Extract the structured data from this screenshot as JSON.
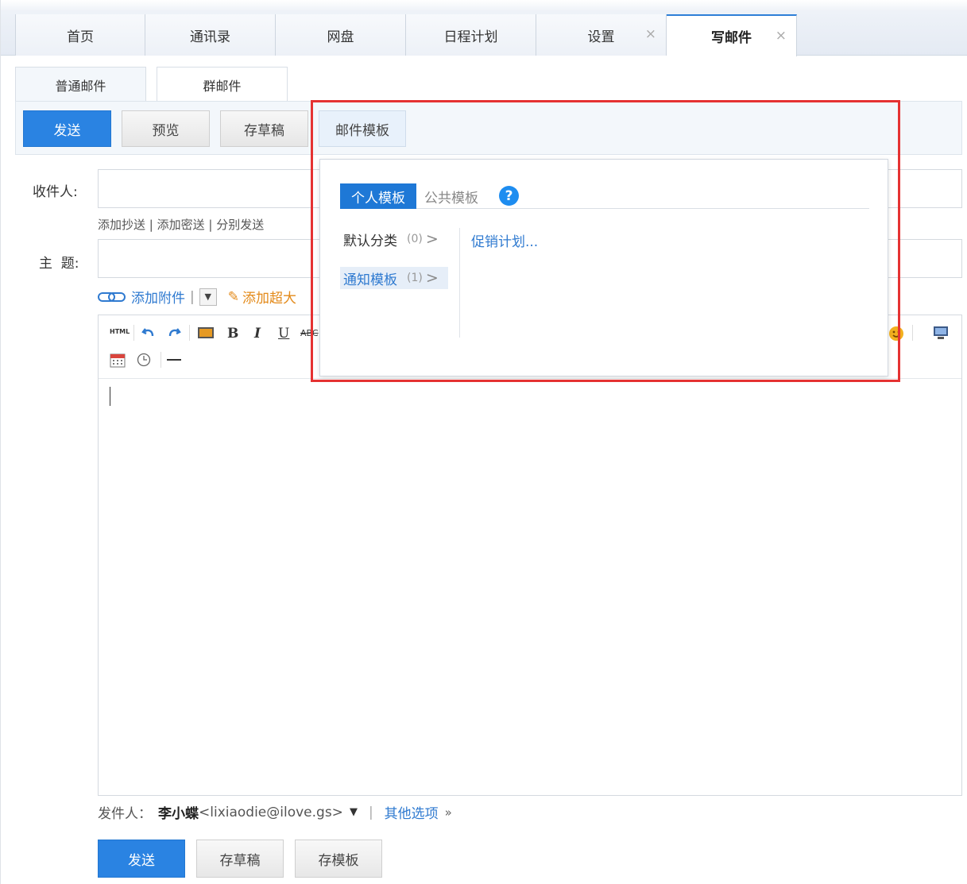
{
  "nav": {
    "tabs": [
      {
        "label": "首页"
      },
      {
        "label": "通讯录"
      },
      {
        "label": "网盘"
      },
      {
        "label": "日程计划"
      },
      {
        "label": "设置",
        "close": "×"
      },
      {
        "label": "写邮件",
        "close": "×"
      }
    ]
  },
  "compose": {
    "type_tabs": [
      {
        "label": "普通邮件"
      },
      {
        "label": "群邮件"
      }
    ],
    "toolbar": {
      "send": "发送",
      "preview": "预览",
      "save_draft": "存草稿",
      "template": "邮件模板"
    },
    "recipient_label": "收件人:",
    "recipient_links": [
      "添加抄送",
      "添加密送",
      "分别发送"
    ],
    "subject_label": "主  题:",
    "attach_label": "添加附件",
    "attach_large_label": "添加超大",
    "editor_tools": {
      "html": "HTML",
      "bold": "B",
      "italic": "I",
      "underline": "U",
      "strike": "ABC"
    }
  },
  "template_popup": {
    "tabs": {
      "personal": "个人模板",
      "public": "公共模板",
      "help": "?"
    },
    "categories": [
      {
        "name": "默认分类",
        "count": "(0)"
      },
      {
        "name": "通知模板",
        "count": "(1)"
      }
    ],
    "items": [
      "促销计划..."
    ]
  },
  "sender": {
    "label": "发件人：",
    "name": "李小蝶",
    "email": "<lixiaodie@ilove.gs>",
    "other_options": "其他选项"
  },
  "bottom_buttons": {
    "send": "发送",
    "save_draft": "存草稿",
    "save_template": "存模板"
  },
  "colors": {
    "primary": "#2a83e2",
    "highlight": "#e53232",
    "link": "#2f7ad0"
  }
}
